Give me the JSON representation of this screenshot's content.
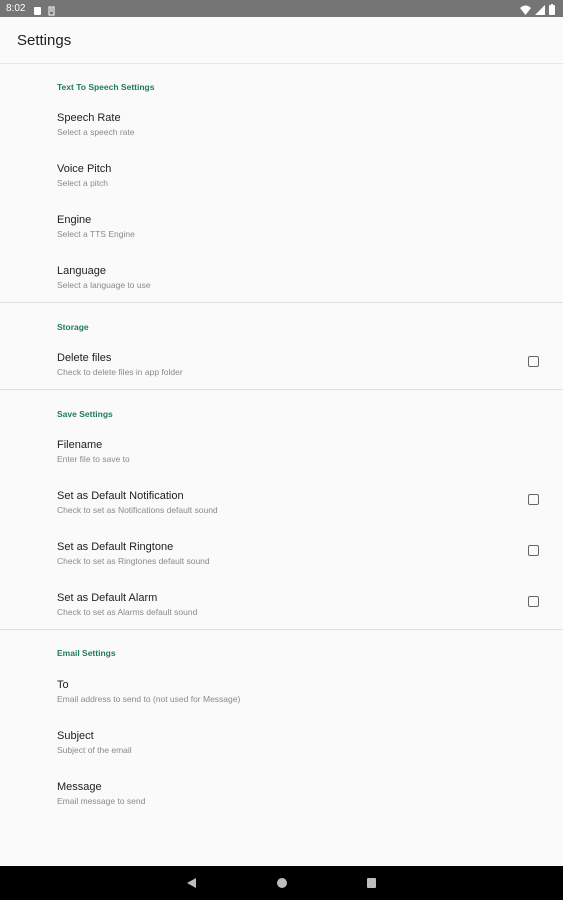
{
  "status": {
    "time": "8:02",
    "icons": [
      "battery-saver-icon",
      "sd-card-icon",
      "wifi-icon",
      "signal-icon",
      "battery-icon"
    ]
  },
  "app_bar": {
    "title": "Settings"
  },
  "sections": {
    "tts": {
      "header": "Text To Speech Settings",
      "items": [
        {
          "title": "Speech Rate",
          "summary": "Select a speech rate"
        },
        {
          "title": "Voice Pitch",
          "summary": "Select a pitch"
        },
        {
          "title": "Engine",
          "summary": "Select a TTS Engine"
        },
        {
          "title": "Language",
          "summary": "Select a language to use"
        }
      ]
    },
    "storage": {
      "header": "Storage",
      "items": [
        {
          "title": "Delete files",
          "summary": "Check to delete files in app folder",
          "checked": false
        }
      ]
    },
    "save": {
      "header": "Save Settings",
      "items": [
        {
          "title": "Filename",
          "summary": "Enter file to save to"
        },
        {
          "title": "Set as Default Notification",
          "summary": "Check to set as Notifications default sound",
          "checked": false
        },
        {
          "title": "Set as Default Ringtone",
          "summary": "Check to set as Ringtones default sound",
          "checked": false
        },
        {
          "title": "Set as Default Alarm",
          "summary": "Check to set as Alarms default sound",
          "checked": false
        }
      ]
    },
    "email": {
      "header": "Email Settings",
      "items": [
        {
          "title": "To",
          "summary": "Email address to send to (not used for Message)"
        },
        {
          "title": "Subject",
          "summary": "Subject of the email"
        },
        {
          "title": "Message",
          "summary": "Email message to send"
        }
      ]
    }
  },
  "colors": {
    "accent": "#1f7a5c",
    "status_bar": "#757575",
    "nav_bar": "#000000",
    "background": "#fafafa"
  }
}
